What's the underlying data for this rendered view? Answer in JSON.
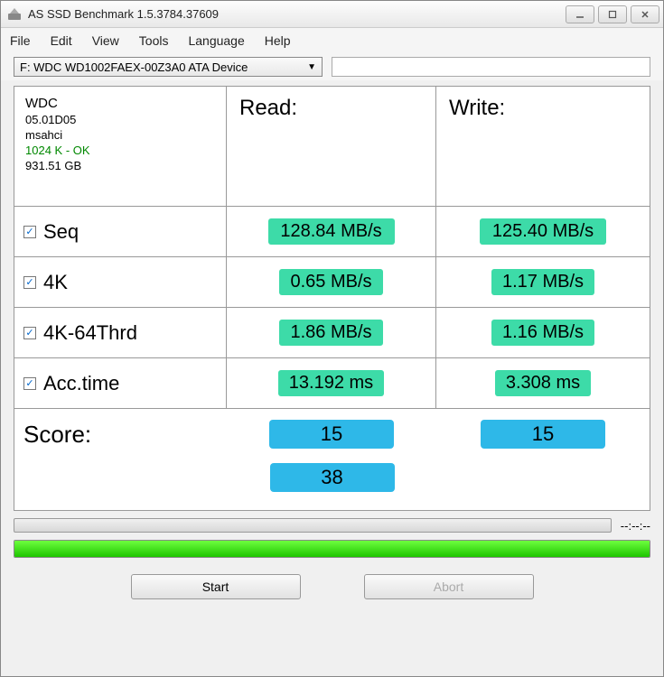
{
  "window": {
    "title": "AS SSD Benchmark 1.5.3784.37609"
  },
  "menu": {
    "file": "File",
    "edit": "Edit",
    "view": "View",
    "tools": "Tools",
    "language": "Language",
    "help": "Help"
  },
  "device": {
    "selected": "F: WDC WD1002FAEX-00Z3A0 ATA Device",
    "vendor": "WDC",
    "firmware": "05.01D05",
    "driver": "msahci",
    "alignment": "1024 K - OK",
    "size": "931.51 GB"
  },
  "headers": {
    "read": "Read:",
    "write": "Write:"
  },
  "tests": {
    "seq": {
      "label": "Seq",
      "read": "128.84 MB/s",
      "write": "125.40 MB/s"
    },
    "k4": {
      "label": "4K",
      "read": "0.65 MB/s",
      "write": "1.17 MB/s"
    },
    "k4_64": {
      "label": "4K-64Thrd",
      "read": "1.86 MB/s",
      "write": "1.16 MB/s"
    },
    "acc": {
      "label": "Acc.time",
      "read": "13.192 ms",
      "write": "3.308 ms"
    }
  },
  "score": {
    "label": "Score:",
    "read": "15",
    "write": "15",
    "total": "38"
  },
  "progress": {
    "time": "--:--:--"
  },
  "buttons": {
    "start": "Start",
    "abort": "Abort"
  }
}
